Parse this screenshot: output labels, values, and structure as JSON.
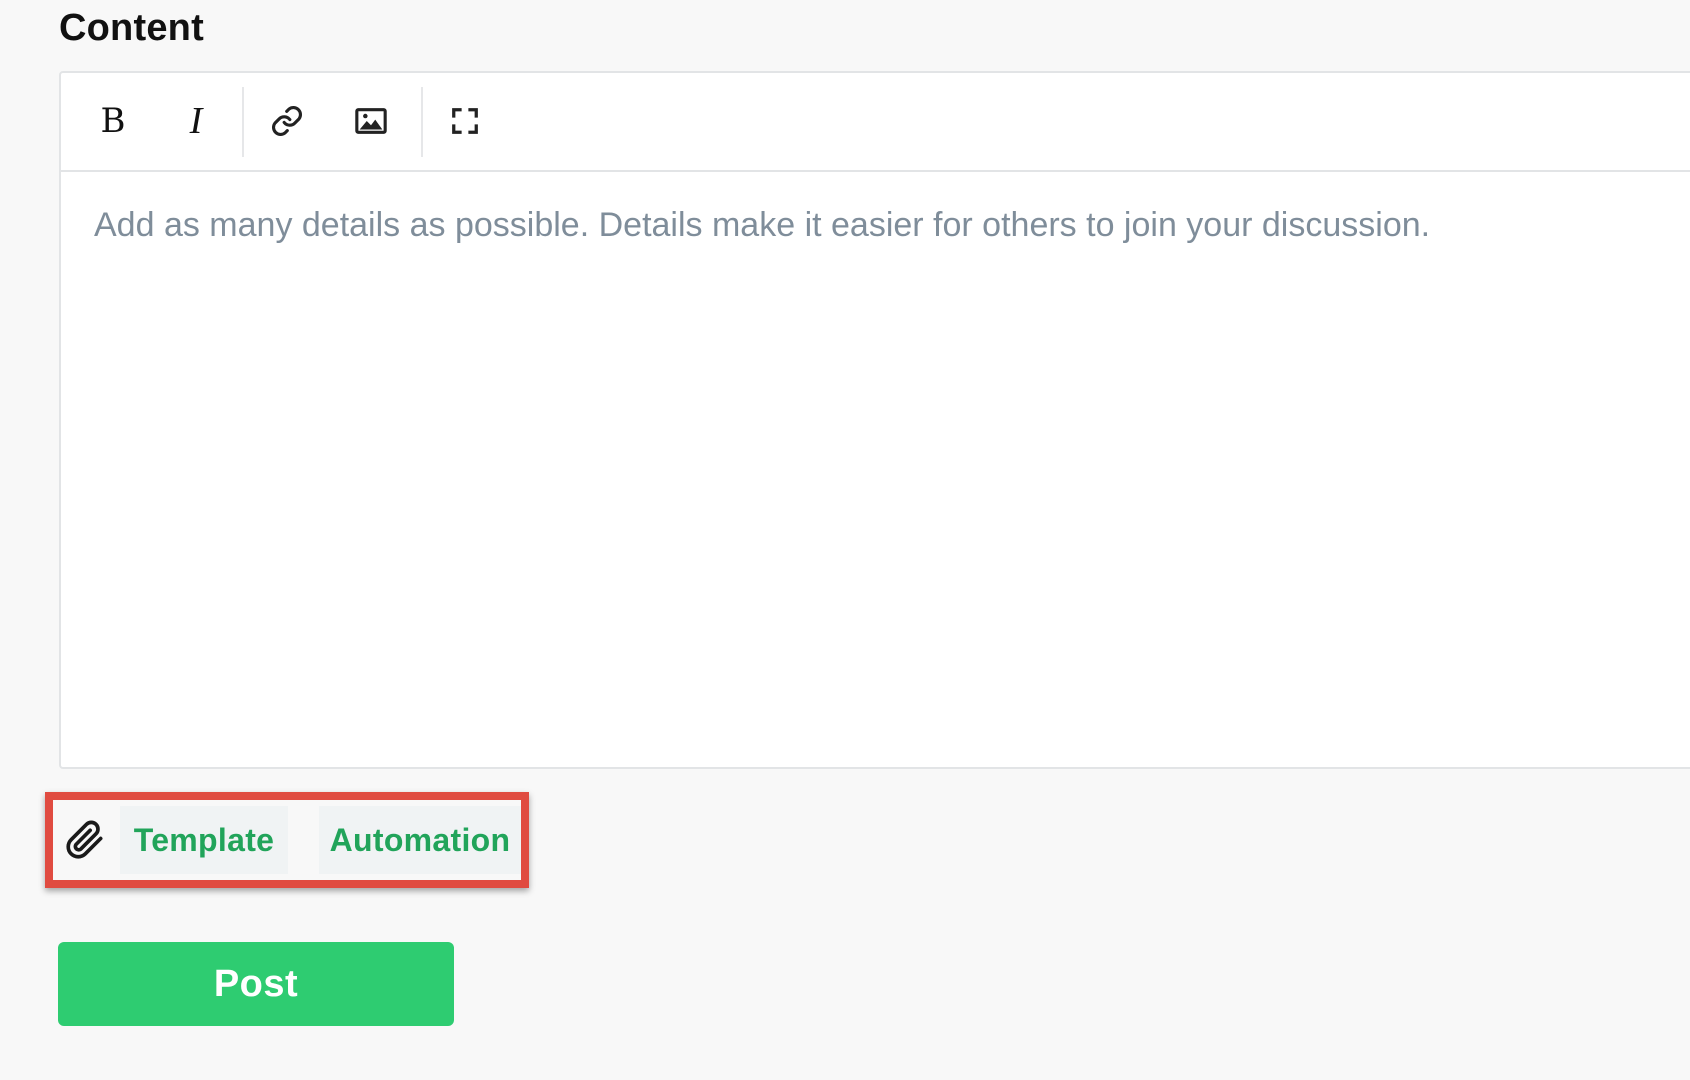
{
  "section": {
    "title": "Content"
  },
  "editor": {
    "toolbar": {
      "bold_label": "B",
      "italic_label": "I",
      "icons": [
        "link-icon",
        "image-icon",
        "fullscreen-icon"
      ]
    },
    "placeholder": "Add as many details as possible. Details make it easier for others to join your discussion."
  },
  "actions": {
    "attach_icon": "paperclip-icon",
    "template_label": "Template",
    "automation_label": "Automation",
    "highlight_color": "#e04b40"
  },
  "post": {
    "label": "Post",
    "color": "#2ecc71"
  },
  "colors": {
    "accent_green_text": "#21a45a",
    "placeholder_text": "#7f8d9a"
  }
}
